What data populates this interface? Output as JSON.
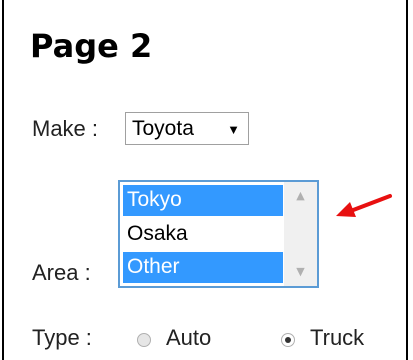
{
  "page": {
    "title": "Page 2"
  },
  "make": {
    "label": "Make :",
    "selected": "Toyota"
  },
  "area": {
    "label": "Area :",
    "options": [
      {
        "label": "Tokyo",
        "selected": true
      },
      {
        "label": "Osaka",
        "selected": false
      },
      {
        "label": "Other",
        "selected": true
      }
    ]
  },
  "type": {
    "label": "Type :",
    "options": [
      {
        "label": "Auto",
        "checked": false
      },
      {
        "label": "Truck",
        "checked": true
      }
    ]
  },
  "colors": {
    "selection": "#3399ff",
    "listbox_border": "#5b9bd5",
    "annotation_arrow": "#e81010"
  },
  "icons": {
    "dropdown": "triangle-down-icon",
    "scroll_up": "triangle-up-icon",
    "scroll_down": "triangle-down-icon",
    "annotation": "red-arrow-icon"
  }
}
